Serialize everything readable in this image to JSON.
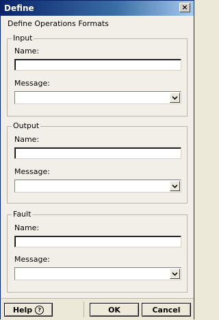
{
  "window": {
    "title": "Define",
    "close_symbol": "×",
    "subtitle": "Define Operations Formats"
  },
  "input": {
    "legend": "Input",
    "name_label": "Name:",
    "name_value": "",
    "message_label": "Message:",
    "message_value": ""
  },
  "output": {
    "legend": "Output",
    "name_label": "Name:",
    "name_value": "",
    "message_label": "Message:",
    "message_value": ""
  },
  "fault": {
    "legend": "Fault",
    "name_label": "Name:",
    "name_value": "",
    "message_label": "Message:",
    "message_value": ""
  },
  "footer": {
    "help_label": "Help",
    "help_icon": "?",
    "ok_label": "OK",
    "cancel_label": "Cancel"
  },
  "colors": {
    "titlebar": "#0a246a",
    "dialog_bg": "#f1efe8",
    "group_border": "#b8b5a8"
  }
}
